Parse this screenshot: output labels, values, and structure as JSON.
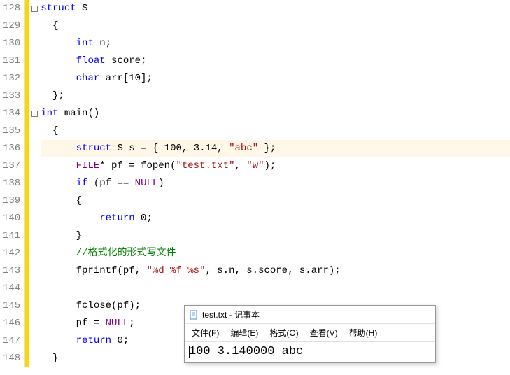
{
  "editor": {
    "lines": [
      {
        "num": "128",
        "fold": "minus",
        "highlight": false,
        "tokens": [
          [
            "kw",
            "struct"
          ],
          [
            "punct",
            " "
          ],
          [
            "class-name",
            "S"
          ]
        ]
      },
      {
        "num": "129",
        "fold": "",
        "highlight": false,
        "tokens": [
          [
            "punct",
            "  {"
          ]
        ]
      },
      {
        "num": "130",
        "fold": "",
        "highlight": false,
        "tokens": [
          [
            "punct",
            "      "
          ],
          [
            "type",
            "int"
          ],
          [
            "punct",
            " n;"
          ]
        ]
      },
      {
        "num": "131",
        "fold": "",
        "highlight": false,
        "tokens": [
          [
            "punct",
            "      "
          ],
          [
            "type",
            "float"
          ],
          [
            "punct",
            " score;"
          ]
        ]
      },
      {
        "num": "132",
        "fold": "",
        "highlight": false,
        "tokens": [
          [
            "punct",
            "      "
          ],
          [
            "type",
            "char"
          ],
          [
            "punct",
            " arr[10];"
          ]
        ]
      },
      {
        "num": "133",
        "fold": "",
        "highlight": false,
        "tokens": [
          [
            "punct",
            "  };"
          ]
        ]
      },
      {
        "num": "134",
        "fold": "minus",
        "highlight": false,
        "tokens": [
          [
            "type",
            "int"
          ],
          [
            "punct",
            " "
          ],
          [
            "ident",
            "main"
          ],
          [
            "punct",
            "()"
          ]
        ]
      },
      {
        "num": "135",
        "fold": "",
        "highlight": false,
        "tokens": [
          [
            "punct",
            "  {"
          ]
        ]
      },
      {
        "num": "136",
        "fold": "",
        "highlight": true,
        "tokens": [
          [
            "punct",
            "      "
          ],
          [
            "kw",
            "struct"
          ],
          [
            "punct",
            " "
          ],
          [
            "class-name",
            "S"
          ],
          [
            "punct",
            " s = { 100, 3.14, "
          ],
          [
            "str",
            "\"abc\""
          ],
          [
            "punct",
            " };"
          ]
        ]
      },
      {
        "num": "137",
        "fold": "",
        "highlight": false,
        "tokens": [
          [
            "punct",
            "      "
          ],
          [
            "macro",
            "FILE"
          ],
          [
            "punct",
            "* pf = fopen("
          ],
          [
            "str",
            "\"test.txt\""
          ],
          [
            "punct",
            ", "
          ],
          [
            "str",
            "\"w\""
          ],
          [
            "punct",
            ");"
          ]
        ]
      },
      {
        "num": "138",
        "fold": "",
        "highlight": false,
        "tokens": [
          [
            "punct",
            "      "
          ],
          [
            "kw",
            "if"
          ],
          [
            "punct",
            " (pf == "
          ],
          [
            "macro",
            "NULL"
          ],
          [
            "punct",
            ")"
          ]
        ]
      },
      {
        "num": "139",
        "fold": "",
        "highlight": false,
        "tokens": [
          [
            "punct",
            "      {"
          ]
        ]
      },
      {
        "num": "140",
        "fold": "",
        "highlight": false,
        "tokens": [
          [
            "punct",
            "          "
          ],
          [
            "kw",
            "return"
          ],
          [
            "punct",
            " 0;"
          ]
        ]
      },
      {
        "num": "141",
        "fold": "",
        "highlight": false,
        "tokens": [
          [
            "punct",
            "      }"
          ]
        ]
      },
      {
        "num": "142",
        "fold": "",
        "highlight": false,
        "tokens": [
          [
            "punct",
            "      "
          ],
          [
            "comment",
            "//格式化的形式写文件"
          ]
        ]
      },
      {
        "num": "143",
        "fold": "",
        "highlight": false,
        "tokens": [
          [
            "punct",
            "      fprintf(pf, "
          ],
          [
            "str",
            "\"%d %f %s\""
          ],
          [
            "punct",
            ", s.n, s.score, s.arr);"
          ]
        ]
      },
      {
        "num": "144",
        "fold": "",
        "highlight": false,
        "tokens": [
          [
            "punct",
            ""
          ]
        ]
      },
      {
        "num": "145",
        "fold": "",
        "highlight": false,
        "tokens": [
          [
            "punct",
            "      fclose(pf);"
          ]
        ]
      },
      {
        "num": "146",
        "fold": "",
        "highlight": false,
        "tokens": [
          [
            "punct",
            "      pf = "
          ],
          [
            "macro",
            "NULL"
          ],
          [
            "punct",
            ";"
          ]
        ]
      },
      {
        "num": "147",
        "fold": "",
        "highlight": false,
        "tokens": [
          [
            "punct",
            "      "
          ],
          [
            "kw",
            "return"
          ],
          [
            "punct",
            " 0;"
          ]
        ]
      },
      {
        "num": "148",
        "fold": "",
        "highlight": false,
        "tokens": [
          [
            "punct",
            "  }"
          ]
        ]
      }
    ]
  },
  "notepad": {
    "title": "test.txt - 记事本",
    "menu": {
      "file": "文件(F)",
      "edit": "编辑(E)",
      "format": "格式(O)",
      "view": "查看(V)",
      "help": "帮助(H)"
    },
    "content": "100 3.140000 abc"
  }
}
